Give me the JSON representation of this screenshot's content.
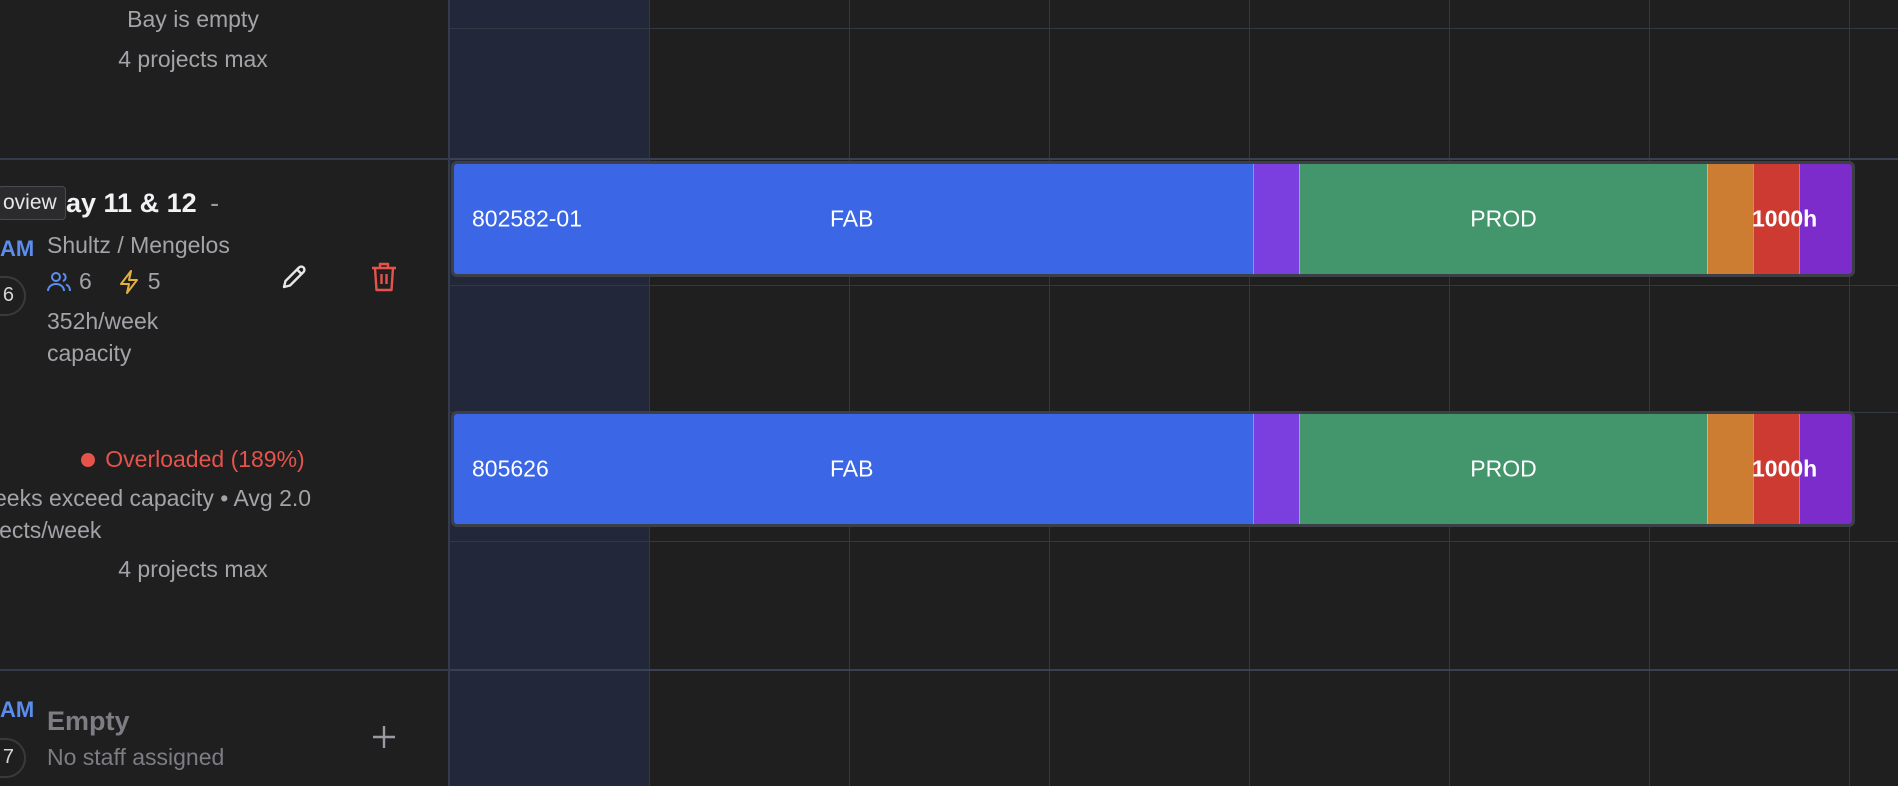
{
  "top_bay": {
    "empty_text": "Bay is empty",
    "max_text": "4 projects max"
  },
  "bay_11_12": {
    "tooltip": "oview",
    "title": "ay 11 & 12",
    "title_suffix": "-",
    "shift_tag": "AM",
    "left_glyph": "6",
    "staff": "Shultz / Mengelos",
    "people_count": "6",
    "power_count": "5",
    "capacity_line1": "352h/week",
    "capacity_line2": "capacity",
    "status": "Overloaded (189%)",
    "detail_line1": "eeks exceed capacity • Avg 2.0",
    "detail_line2": "jects/week",
    "max_text": "4 projects max",
    "colors": {
      "status_red": "#e5534b",
      "people_blue": "#5b8def",
      "power_yellow": "#e3b23c",
      "trash_red": "#e5534b"
    }
  },
  "empty_bay": {
    "shift_tag": "AM",
    "left_glyph": "7",
    "title": "Empty",
    "subtitle": "No staff assigned"
  },
  "projects": [
    {
      "id": "802582-01",
      "fab_label": "FAB",
      "prod_label": "PROD",
      "hours_label": "1000h"
    },
    {
      "id": "805626",
      "fab_label": "FAB",
      "prod_label": "PROD",
      "hours_label": "1000h"
    }
  ],
  "phase_colors": {
    "fab": "#3b66e6",
    "purple": "#7b3fe0",
    "prod": "#43956c",
    "orange": "#cc7d31",
    "red": "#cd3a32",
    "end_purple": "#7b2ccb"
  },
  "icons": [
    "people-icon",
    "lightning-icon",
    "pencil-icon",
    "trash-icon",
    "plus-icon"
  ]
}
